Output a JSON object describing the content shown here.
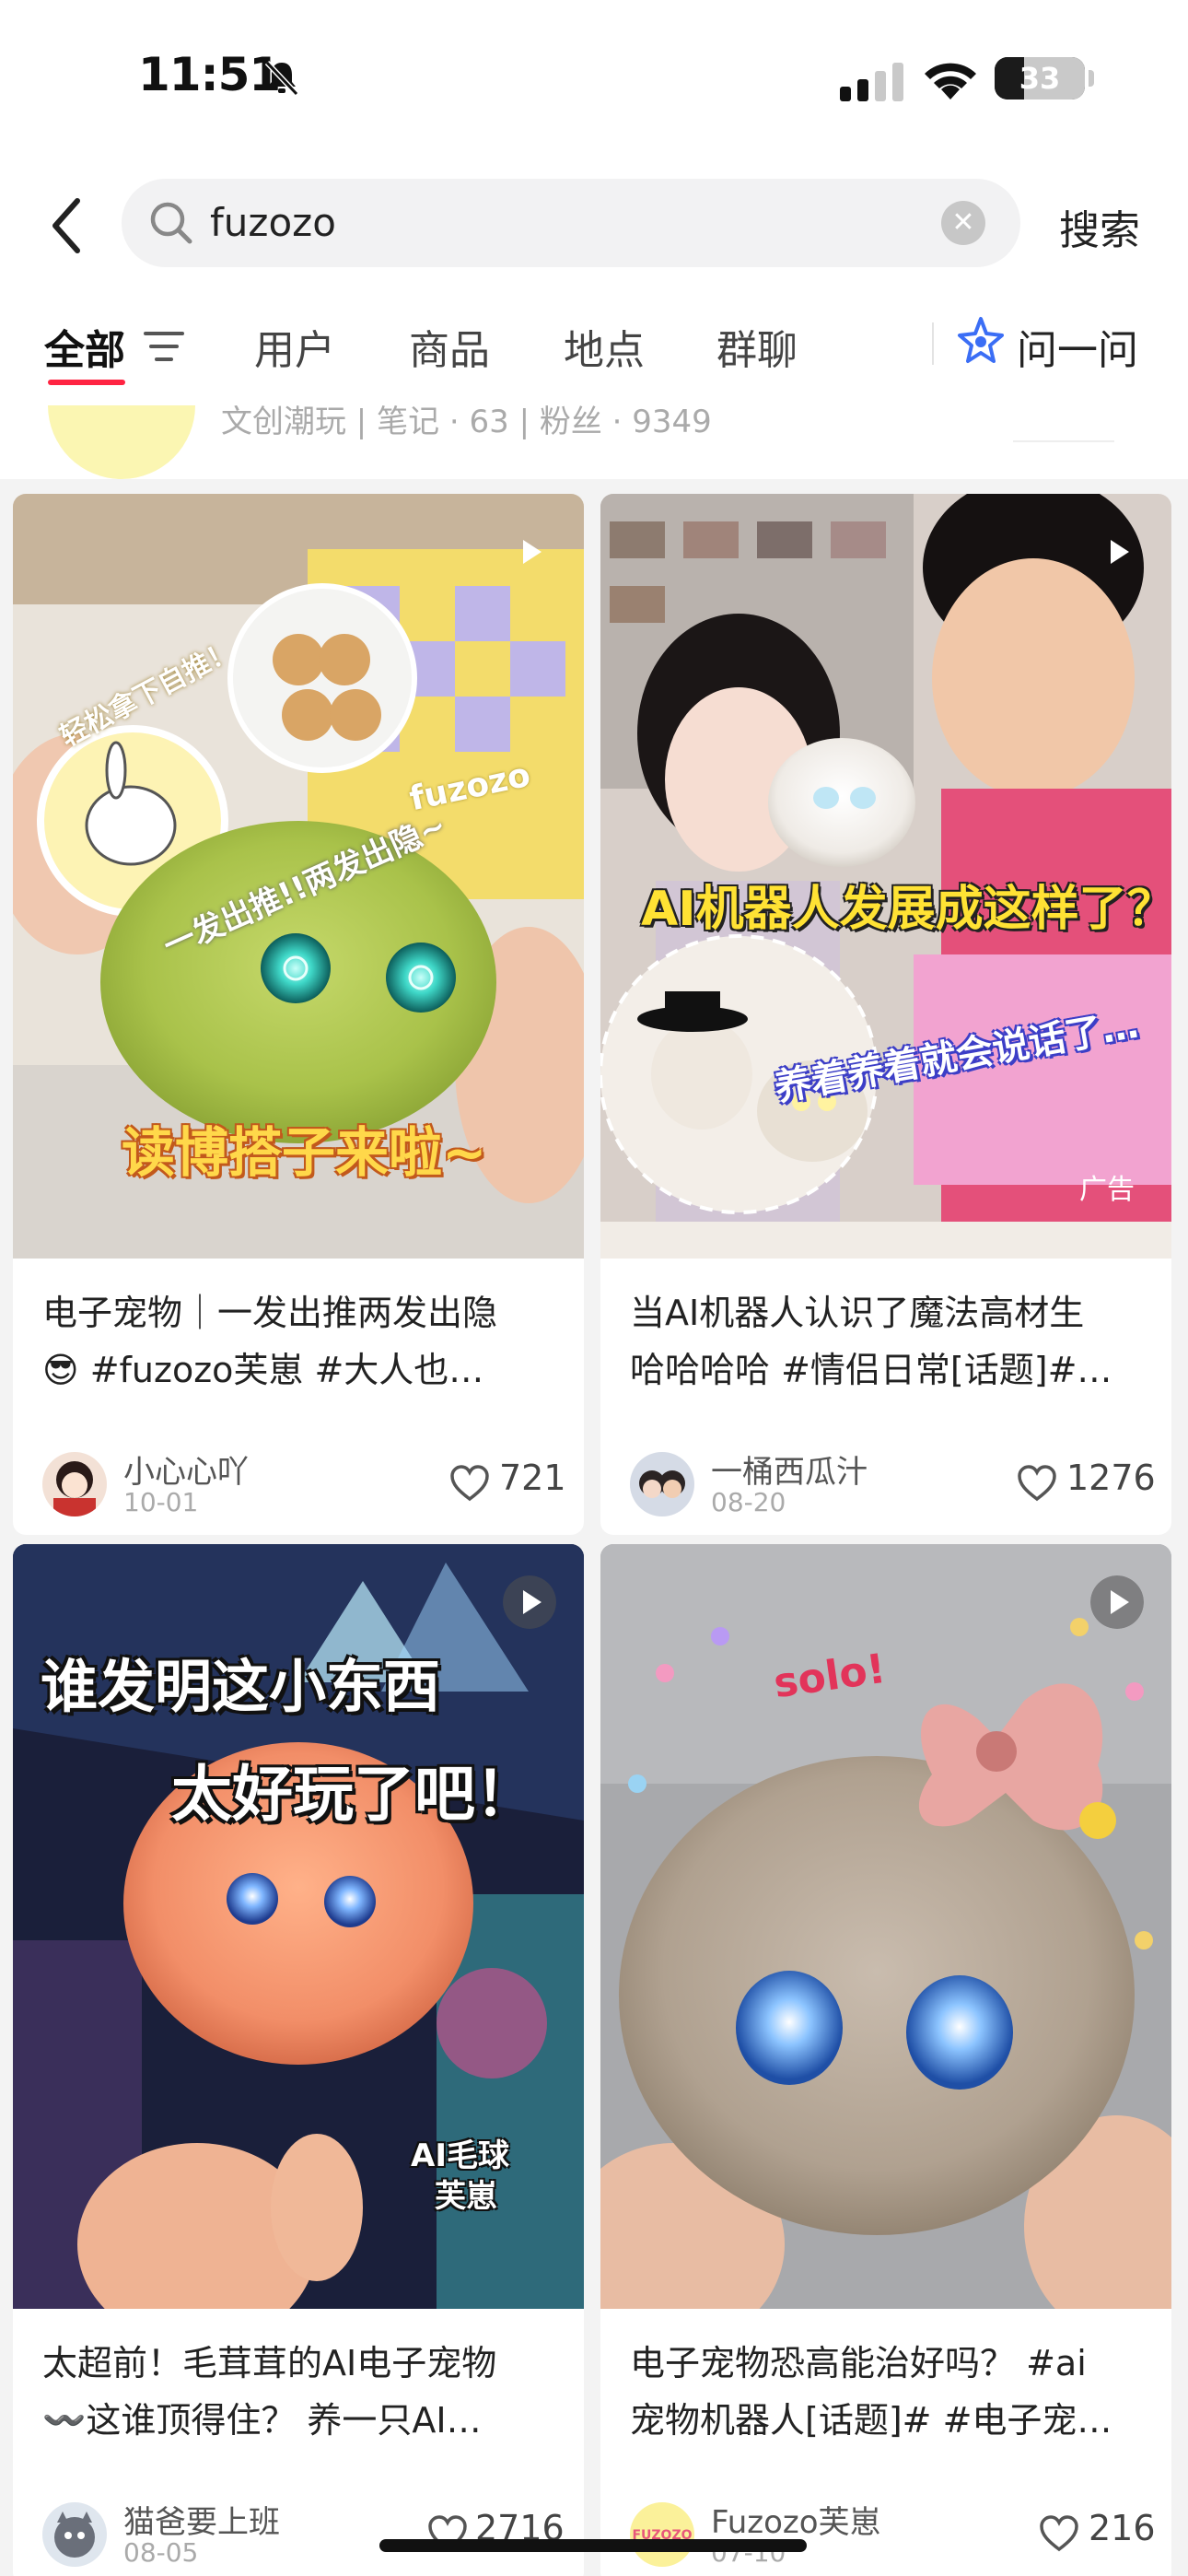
{
  "status_bar": {
    "time": "11:51",
    "battery_level": "33",
    "battery_fraction": 0.33
  },
  "search": {
    "query": "fuzozo",
    "submit_label": "搜索"
  },
  "tabs": [
    {
      "label": "全部",
      "active": true
    },
    {
      "label": "用户"
    },
    {
      "label": "商品"
    },
    {
      "label": "地点"
    },
    {
      "label": "群聊"
    }
  ],
  "ask": {
    "label": "问一问"
  },
  "user_result": {
    "meta": "文创潮玩 | 笔记 · 63 | 粉丝 · 9349"
  },
  "cards": [
    {
      "title_line1": "电子宠物｜一发出推两发出隐",
      "title_line2": "😎 #fuzozo芙崽 #大人也…",
      "author": "小心心吖",
      "date": "10-01",
      "likes": "721",
      "overlay_text_1": "轻松拿下自推！",
      "overlay_text_2": "一发出推!!两发出隐~",
      "overlay_text_3": "读博搭子来啦~",
      "overlay_text_4": "fuzozo"
    },
    {
      "title_line1": "当AI机器人认识了魔法高材生",
      "title_line2": "哈哈哈哈 #情侣日常[话题]#…",
      "author": "一桶西瓜汁",
      "date": "08-20",
      "likes": "1276",
      "overlay_text_1": "AI机器人发展成这样了？",
      "overlay_text_2": "养着养着就会说话了…",
      "ad_label": "广告"
    },
    {
      "title_line1": "太超前！毛茸茸的AI电子宠物",
      "title_line2": "〰️这谁顶得住？ 养一只AI…",
      "author": "猫爸要上班",
      "date": "08-05",
      "likes": "2716",
      "overlay_text_1": "谁发明这小东西",
      "overlay_text_2": "太好玩了吧！",
      "overlay_text_3": "AI毛球",
      "overlay_text_4": "芙崽"
    },
    {
      "title_line1": "电子宠物恐高能治好吗？ #ai",
      "title_line2": "宠物机器人[话题]# #电子宠…",
      "author": "Fuzozo芙崽",
      "date": "07-10",
      "likes": "216",
      "overlay_text_1": "solo!",
      "avatar_text": "FUZOZO"
    }
  ],
  "icons": [
    "bell-slash-icon",
    "signal-icon",
    "wifi-icon",
    "battery-icon",
    "back-icon",
    "search-icon",
    "clear-icon",
    "filter-icon",
    "sparkle-icon",
    "play-icon",
    "heart-icon"
  ],
  "colors": {
    "accent": "#ff2442",
    "background": "#f3f3f3",
    "card": "#ffffff"
  }
}
